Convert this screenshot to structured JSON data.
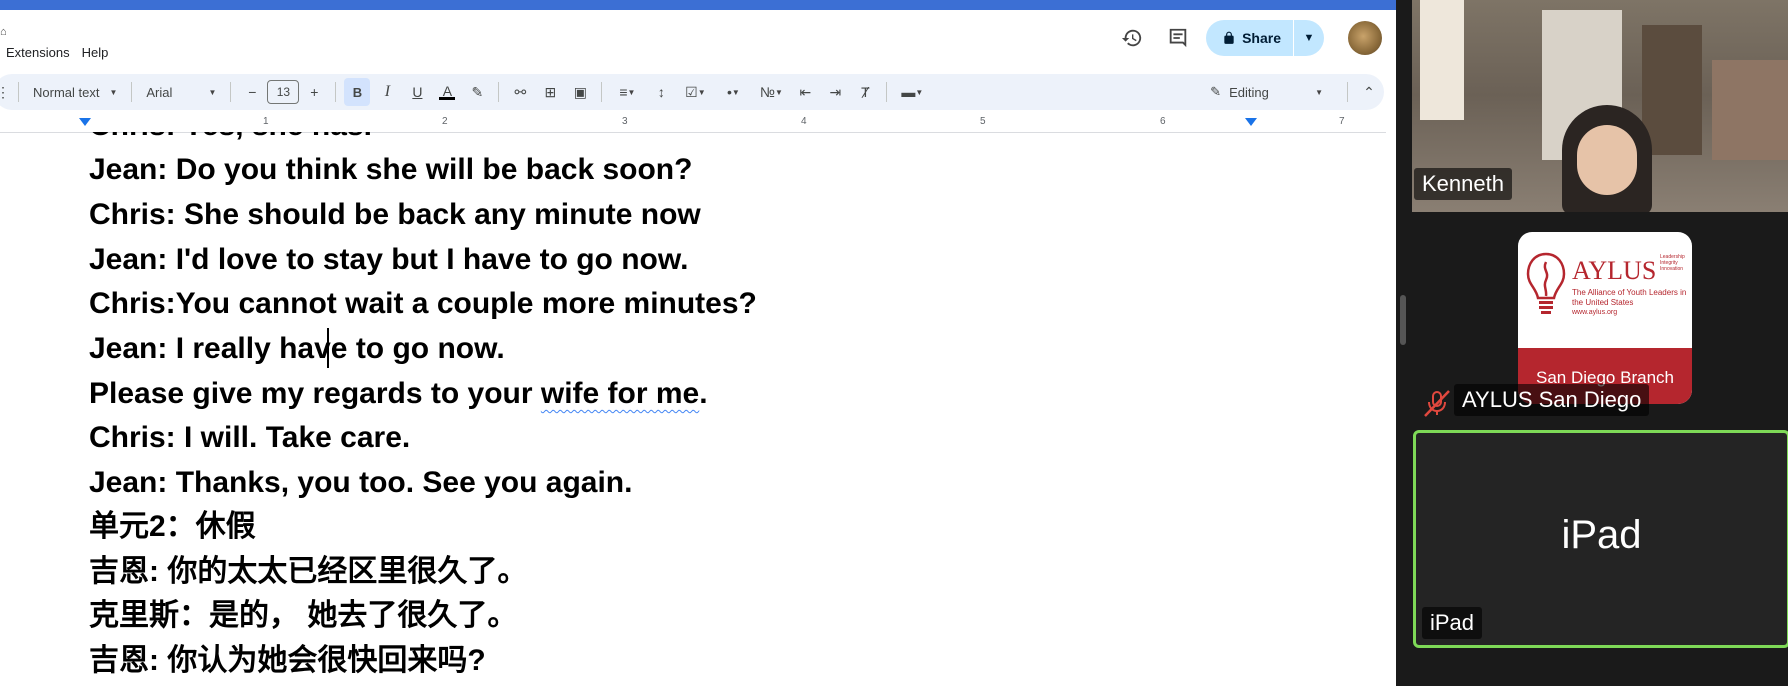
{
  "menu": [
    "Extensions",
    "Help"
  ],
  "header": {
    "share_label": "Share"
  },
  "toolbar": {
    "style": "Normal text",
    "font": "Arial",
    "font_size": "13",
    "mode": "Editing"
  },
  "ruler": {
    "numbers": [
      "1",
      "2",
      "3",
      "4",
      "5",
      "6",
      "7"
    ]
  },
  "document": {
    "lines": [
      "Chris:  Yes, she has.",
      "Jean:  Do you think she will be back soon?",
      "Chris: She should be back any minute now",
      "Jean:  I'd love to stay but I have to go now.",
      "Chris:You cannot wait a couple more minutes?",
      "Jean: I really have to go now.",
      " Please give my regards to your ",
      "wife for me",
      ".",
      "Chris: I will. Take care.",
      "Jean: Thanks, you too. See you again.",
      " 单元2：休假",
      "吉恩: 你的太太已经区里很久了。",
      "克里斯：是的， 她去了很久了。",
      "吉恩: 你认为她会很快回来吗?"
    ]
  },
  "participants": {
    "kenneth": "Kenneth",
    "aylus": {
      "name": "AYLUS San Diego",
      "logo_mark": "AYLUS",
      "logo_sub": "The Alliance of Youth Leaders in the United States",
      "logo_url": "www.aylus.org",
      "logo_side": "Leadership Integrity Innovation",
      "logo_branch": "San Diego Branch"
    },
    "ipad": {
      "center": "iPad",
      "label": "iPad"
    }
  },
  "colors": {
    "docs_blue": "#3c6fd4",
    "share_bg": "#c2e7ff",
    "toolbar_bg": "#edf2fa",
    "active_speaker": "#7ed957",
    "aylus_red": "#b5262e"
  },
  "icons": [
    "version-history-icon",
    "comments-icon",
    "lock-icon",
    "pencil-icon",
    "muted-mic-icon"
  ]
}
